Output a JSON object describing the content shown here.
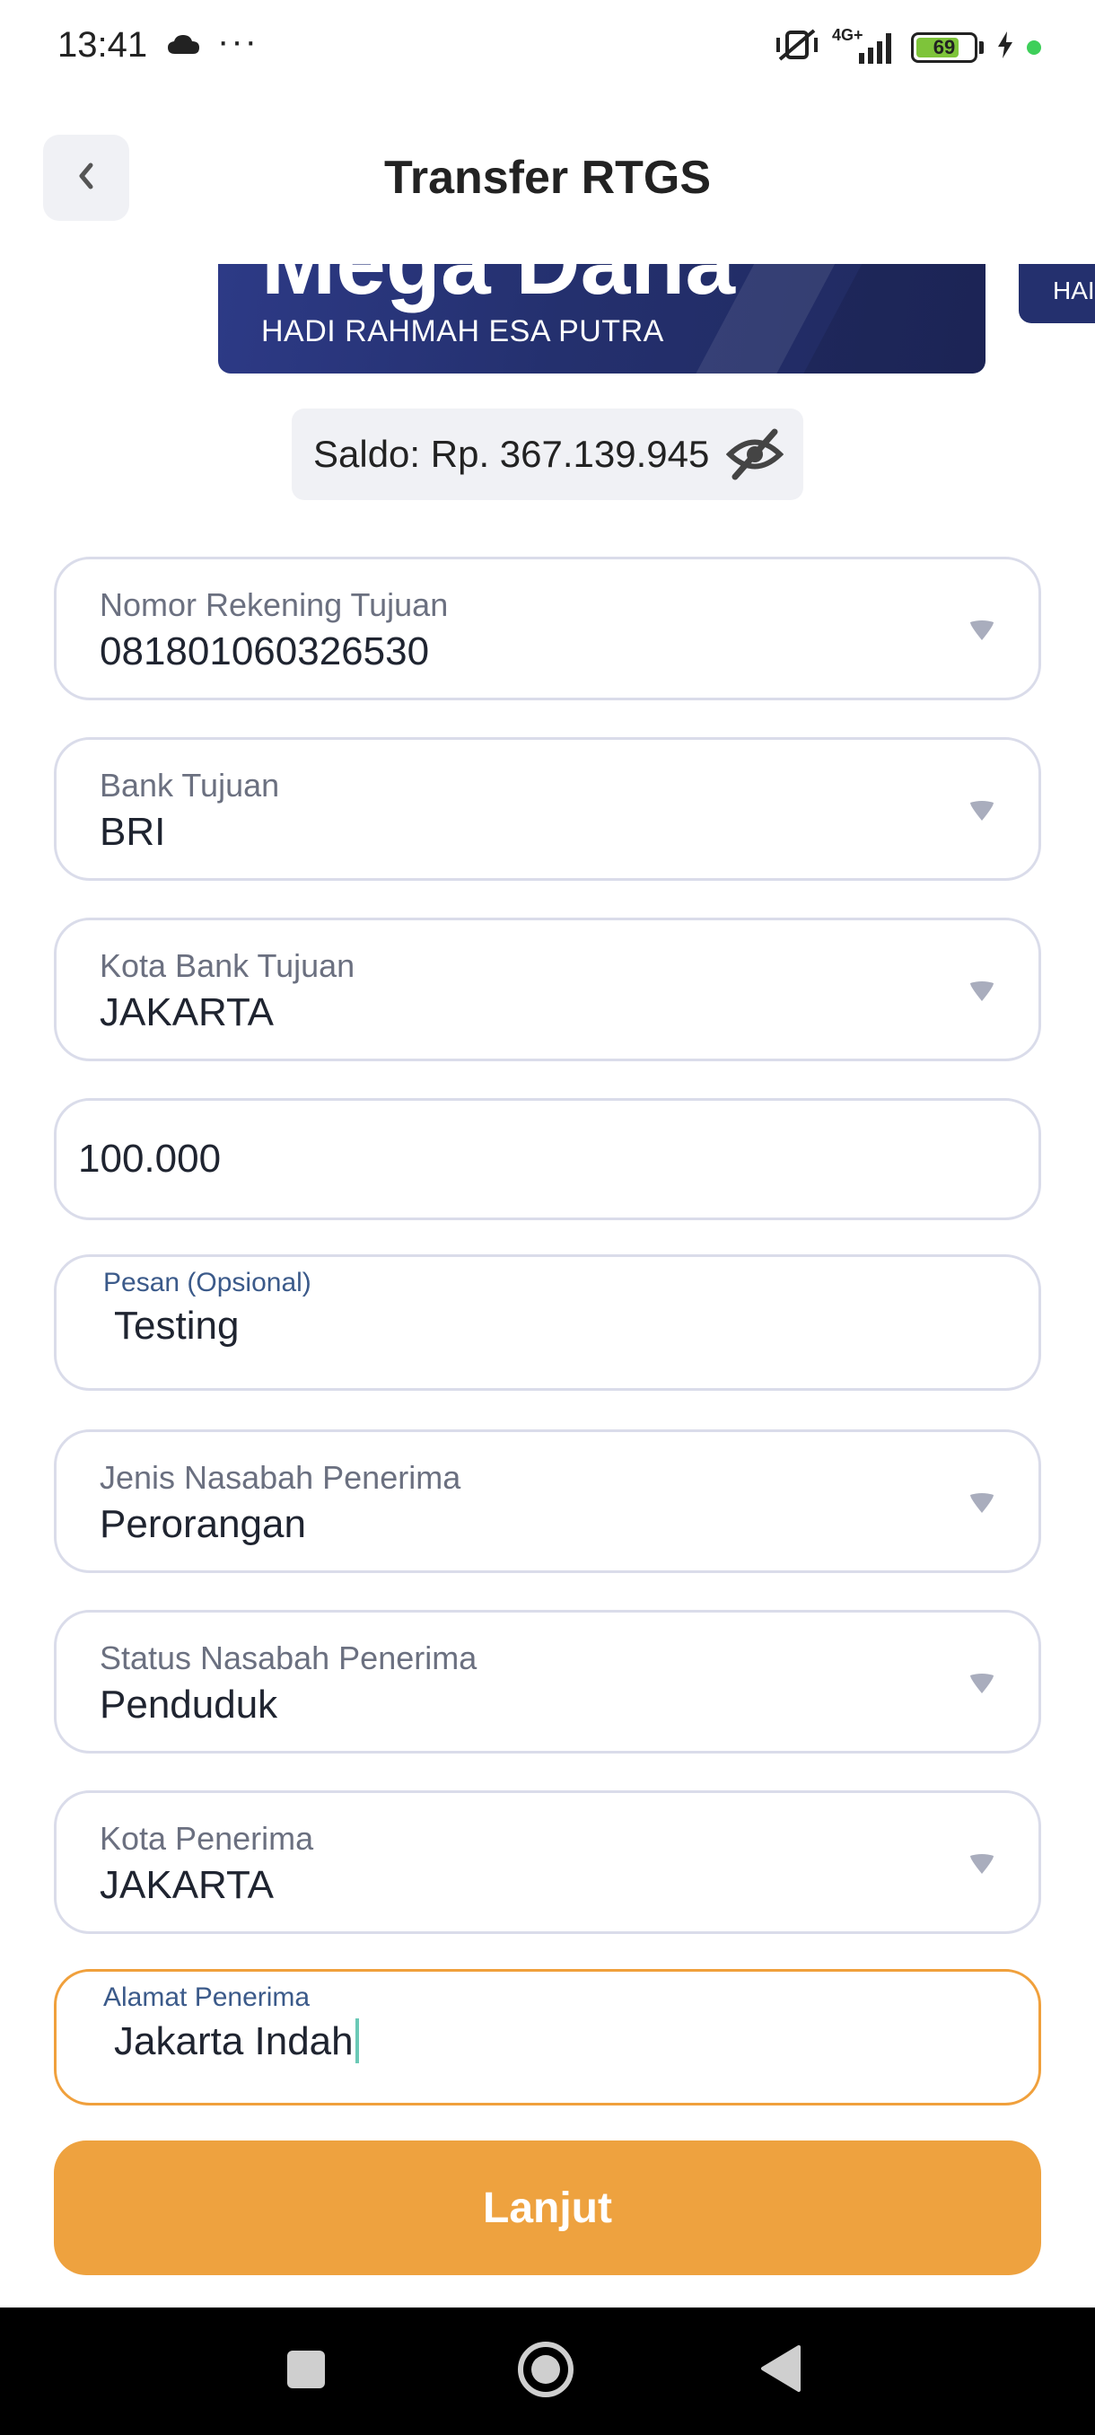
{
  "status_bar": {
    "time": "13:41",
    "dots": "···",
    "network": "4G+",
    "battery": "69"
  },
  "header": {
    "title": "Transfer RTGS"
  },
  "card": {
    "product_name": "Mega Dana",
    "holder_name": "HADI RAHMAH ESA PUTRA",
    "next_card_holder_fragment": "HAI"
  },
  "balance": {
    "text": "Saldo: Rp. 367.139.945"
  },
  "form": {
    "account_number": {
      "label": "Nomor Rekening Tujuan",
      "value": "081801060326530"
    },
    "bank": {
      "label": "Bank Tujuan",
      "value": "BRI"
    },
    "bank_city": {
      "label": "Kota Bank Tujuan",
      "value": "JAKARTA"
    },
    "amount": {
      "value": "100.000"
    },
    "message": {
      "label": "Pesan (Opsional)",
      "value": "Testing"
    },
    "customer_type": {
      "label": "Jenis Nasabah Penerima",
      "value": "Perorangan"
    },
    "customer_status": {
      "label": "Status Nasabah Penerima",
      "value": "Penduduk"
    },
    "recipient_city": {
      "label": "Kota Penerima",
      "value": "JAKARTA"
    },
    "recipient_address": {
      "label": "Alamat Penerima",
      "value": "Jakarta Indah"
    }
  },
  "actions": {
    "next_label": "Lanjut"
  },
  "colors": {
    "accent": "#eea23f",
    "card_navy": "#24306e",
    "field_border": "#dadcea",
    "focus_border": "#f0a03c"
  }
}
